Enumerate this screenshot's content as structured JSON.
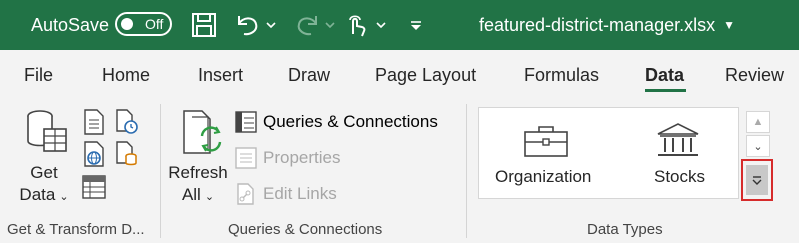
{
  "titlebar": {
    "autosave_label": "AutoSave",
    "autosave_state": "Off",
    "filename": "featured-district-manager.xlsx",
    "bg_color": "#217346"
  },
  "tabs": [
    {
      "label": "File"
    },
    {
      "label": "Home"
    },
    {
      "label": "Insert"
    },
    {
      "label": "Draw"
    },
    {
      "label": "Page Layout"
    },
    {
      "label": "Formulas"
    },
    {
      "label": "Data",
      "active": true
    },
    {
      "label": "Review"
    }
  ],
  "ribbon": {
    "get_transform": {
      "get_data_line1": "Get",
      "get_data_line2": "Data",
      "group_label": "Get & Transform D..."
    },
    "queries": {
      "refresh_line1": "Refresh",
      "refresh_line2": "All",
      "queries_connections": "Queries & Connections",
      "properties": "Properties",
      "edit_links": "Edit Links",
      "group_label": "Queries & Connections"
    },
    "data_types": {
      "organization": "Organization",
      "stocks": "Stocks",
      "group_label": "Data Types"
    }
  },
  "icons": {
    "save": "save-icon",
    "undo": "undo-icon",
    "redo": "redo-icon",
    "touch": "touch-mode-icon",
    "customize": "customize-qat-icon"
  },
  "colors": {
    "accent": "#217346",
    "highlight_border": "#d62b2b"
  }
}
